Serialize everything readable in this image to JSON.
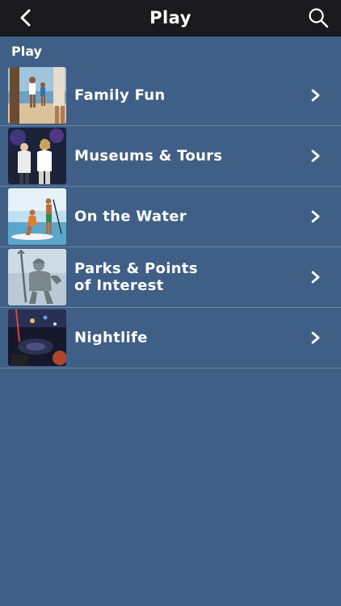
{
  "header": {
    "title": "Play"
  },
  "section": {
    "label": "Play"
  },
  "items": [
    {
      "label": "Family Fun",
      "icon": "beach-family-photo"
    },
    {
      "label": "Museums & Tours",
      "icon": "museum-people-photo"
    },
    {
      "label": "On the Water",
      "icon": "paddleboard-photo"
    },
    {
      "label": "Parks & Points\nof Interest",
      "icon": "neptune-statue-photo"
    },
    {
      "label": "Nightlife",
      "icon": "nightclub-photo"
    }
  ]
}
